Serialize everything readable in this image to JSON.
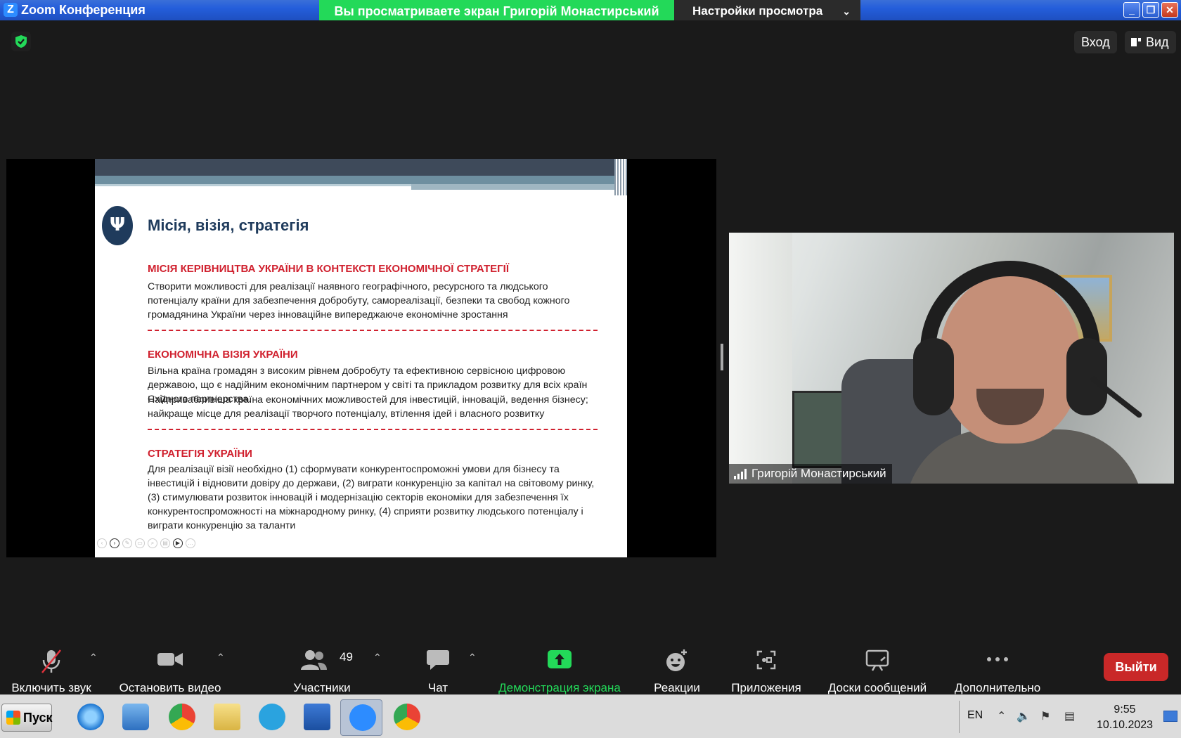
{
  "window": {
    "title": "Zoom Конференция",
    "share_banner": "Вы просматриваете экран Григорій Монастирський",
    "view_settings": "Настройки просмотра"
  },
  "topbar": {
    "signin": "Вход",
    "view": "Вид"
  },
  "slide": {
    "title": "Місія, візія, стратегія",
    "sections": [
      {
        "heading": "МІСІЯ КЕРІВНИЦТВА УКРАЇНИ В КОНТЕКСТІ ЕКОНОМІЧНОЇ СТРАТЕГІЇ",
        "body": "Створити можливості для реалізації наявного географічного, ресурсного та людського потенціалу країни для забезпечення добробуту, самореалізації, безпеки та свобод кожного громадянина України через інноваційне випереджаюче економічне зростання"
      },
      {
        "heading": "ЕКОНОМІЧНА ВІЗІЯ УКРАЇНИ",
        "body": "Вільна країна громадян з високим рівнем добробуту та ефективною сервісною цифровою державою, що є надійним економічним партнером у світі та прикладом розвитку для всіх країн Східного партнерства.",
        "body2": "Найпривабливіша країна економічних можливостей для інвестицій, інновацій, ведення бізнесу; найкраще місце для реалізації творчого потенціалу, втілення ідей і власного розвитку"
      },
      {
        "heading": "СТРАТЕГІЯ УКРАЇНИ",
        "body": "Для реалізації візії необхідно (1) сформувати конкурентоспроможні умови для бізнесу та інвестицій і відновити довіру до держави, (2) виграти конкуренцію за капітал на світовому ринку, (3) стимулювати розвиток інновацій і модернізацію секторів економіки для забезпечення їх конкурентоспроможності на міжнародному ринку, (4) сприяти розвитку людського потенціалу і виграти конкуренцію за таланти"
      }
    ]
  },
  "participant": {
    "name": "Григорій Монастирський"
  },
  "toolbar": {
    "audio": "Включить звук",
    "video": "Остановить видео",
    "participants": "Участники",
    "participants_count": "49",
    "chat": "Чат",
    "share": "Демонстрация экрана",
    "reactions": "Реакции",
    "apps": "Приложения",
    "whiteboards": "Доски сообщений",
    "more": "Дополнительно",
    "exit": "Выйти"
  },
  "taskbar": {
    "start": "Пуск",
    "lang": "EN",
    "time": "9:55",
    "date": "10.10.2023"
  },
  "colors": {
    "share_green": "#23d959",
    "exit_red": "#c92828",
    "slide_title_blue": "#1f3b5c",
    "slide_heading_red": "#d0202e"
  }
}
